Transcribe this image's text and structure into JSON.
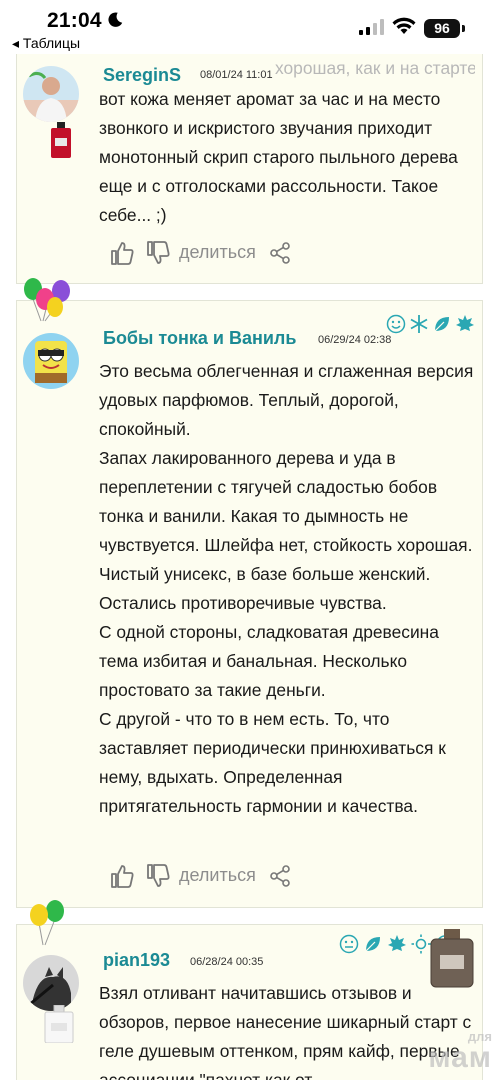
{
  "status_bar": {
    "time": "21:04",
    "back_label": "◂ Таблицы",
    "battery": "96"
  },
  "reviews": [
    {
      "user": "SereginS",
      "date": "08/01/24 11:01",
      "text_top_fragment": "хорошая, как и на старте много часов. А",
      "text": [
        "вот кожа меняет аромат за час и на место звонкого и искристого звучания приходит монотонный скрип старого пыльного дерева еще и с отголосками рассольности. Такое себе... ;)"
      ],
      "share_label": "делиться"
    },
    {
      "user": "Бобы тонка и Ваниль",
      "date": "06/29/24 02:38",
      "text": [
        "Это весьма облегченная и сглаженная версия удовых парфюмов. Теплый, дорогой, спокойный.",
        "Запах лакированного дерева и уда в переплетении с тягучей сладостью бобов тонка и ванили. Какая то дымность не чувствуется. Шлейфа нет, стойкость хорошая. Чистый унисекс, в базе больше женский.",
        "Остались противоречивые чувства.",
        "С одной стороны, сладковатая древесина тема избитая и банальная. Несколько простовато за такие деньги.",
        "С другой - что то в нем есть. То, что заставляет периодически принюхиваться к нему, вдыхать. Определенная притягательность гармонии и качества."
      ],
      "share_label": "делиться"
    },
    {
      "user": "pian193",
      "date": "06/28/24 00:35",
      "text": [
        "Взял отливант начитавшись отзывов и обзоров, первое нанесение шикарный старт с геле душевым оттенком, прям кайф, первые ассоциации \"пахнет как от"
      ],
      "share_label": "делиться"
    }
  ],
  "watermark": {
    "top": "для",
    "bottom": "мам"
  },
  "colors": {
    "username": "#1b8a94",
    "card_bg": "#fdfdf0",
    "icon_teal": "#2aa7b3"
  }
}
